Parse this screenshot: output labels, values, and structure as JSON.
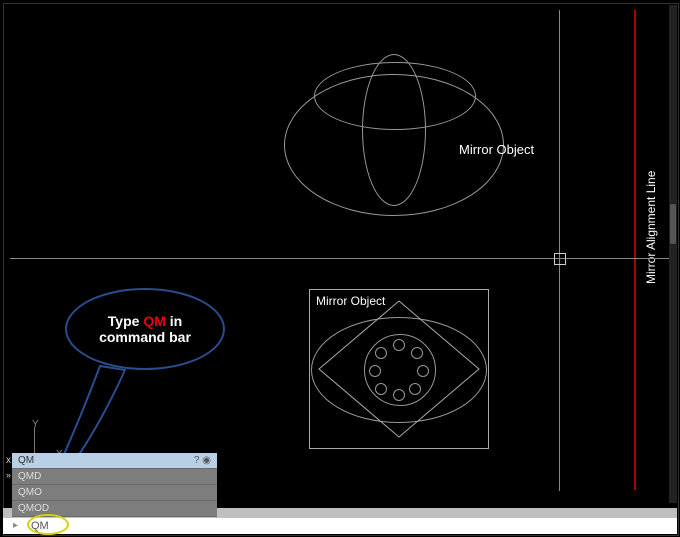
{
  "labels": {
    "mirror_object_top": "Mirror Object",
    "mirror_object_bottom": "Mirror Object",
    "mirror_alignment_line": "Mirror Alignment Line"
  },
  "ucs": {
    "x": "X",
    "y": "Y"
  },
  "autocomplete": {
    "items": [
      "QM",
      "QMD",
      "QMO",
      "QMOD"
    ],
    "selected_index": 0
  },
  "command_bar": {
    "prompt_icon": "▸",
    "typed": "QM",
    "close_label": "x",
    "chevron": "»"
  },
  "callout": {
    "prefix": "Type ",
    "highlight": "QM",
    "suffix": " in command bar"
  },
  "icons": {
    "help": "?",
    "globe": "◉"
  }
}
